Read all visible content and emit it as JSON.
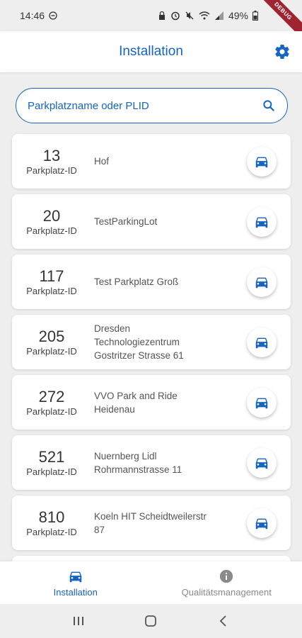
{
  "status_bar": {
    "time": "14:46",
    "battery": "49%",
    "debug_label": "DEBUG"
  },
  "app_bar": {
    "title": "Installation",
    "settings_icon": "gear-icon"
  },
  "search": {
    "placeholder": "Parkplatzname oder PLID"
  },
  "parking_lots": [
    {
      "id": "13",
      "id_label": "Parkplatz-ID",
      "name": "Hof"
    },
    {
      "id": "20",
      "id_label": "Parkplatz-ID",
      "name": "TestParkingLot"
    },
    {
      "id": "117",
      "id_label": "Parkplatz-ID",
      "name": "Test Parkplatz Groß"
    },
    {
      "id": "205",
      "id_label": "Parkplatz-ID",
      "name": "Dresden\nTechnologiezentrum\nGostritzer Strasse 61"
    },
    {
      "id": "272",
      "id_label": "Parkplatz-ID",
      "name": "VVO Park and Ride\nHeidenau"
    },
    {
      "id": "521",
      "id_label": "Parkplatz-ID",
      "name": "Nuernberg Lidl\nRohrmannstrasse 11"
    },
    {
      "id": "810",
      "id_label": "Parkplatz-ID",
      "name": "Koeln HIT Scheidtweilerstr\n87"
    }
  ],
  "bottom_nav": {
    "items": [
      {
        "label": "Installation",
        "icon": "car-icon",
        "active": true
      },
      {
        "label": "Qualitätsmanagement",
        "icon": "info-icon",
        "active": false
      }
    ]
  },
  "colors": {
    "accent": "#1565c0",
    "background": "#eeeeee",
    "card": "#ffffff",
    "debug_ribbon": "#a02332"
  }
}
